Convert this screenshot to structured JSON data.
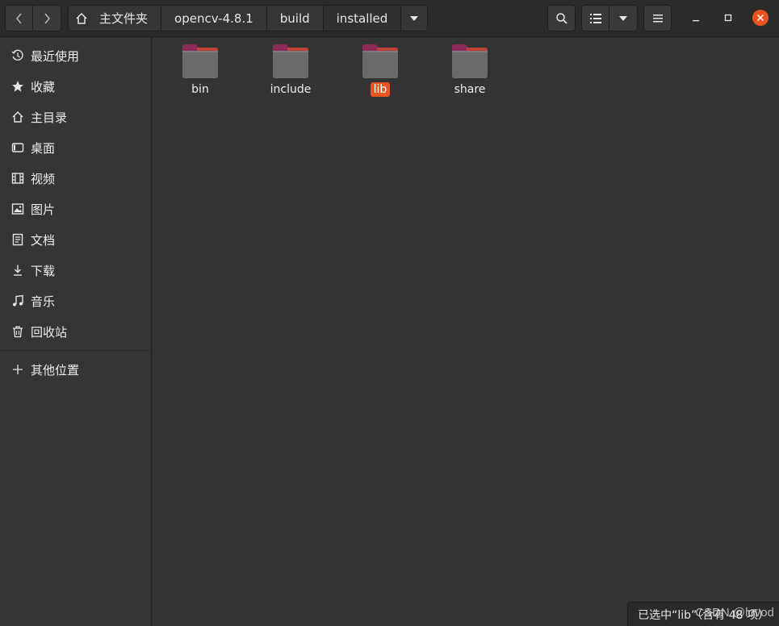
{
  "breadcrumb": {
    "items": [
      "主文件夹",
      "opencv-4.8.1",
      "build",
      "installed"
    ]
  },
  "icons": {
    "back": "chevron-left-icon",
    "forward": "chevron-right-icon",
    "home": "home-icon",
    "search": "search-icon",
    "list_view": "list-view-icon",
    "view_options": "chevron-down-icon",
    "menu": "hamburger-menu-icon",
    "minimize": "minimize-icon",
    "maximize": "maximize-icon",
    "close": "close-icon"
  },
  "sidebar": {
    "items": [
      {
        "label": "最近使用",
        "icon": "clock-icon"
      },
      {
        "label": "收藏",
        "icon": "star-icon"
      },
      {
        "label": "主目录",
        "icon": "home-icon"
      },
      {
        "label": "桌面",
        "icon": "desktop-icon"
      },
      {
        "label": "视频",
        "icon": "film-icon"
      },
      {
        "label": "图片",
        "icon": "image-icon"
      },
      {
        "label": "文档",
        "icon": "document-icon"
      },
      {
        "label": "下载",
        "icon": "download-icon"
      },
      {
        "label": "音乐",
        "icon": "music-icon"
      },
      {
        "label": "回收站",
        "icon": "trash-icon"
      }
    ],
    "other": {
      "label": "其他位置",
      "icon": "plus-icon"
    }
  },
  "files": [
    {
      "name": "bin",
      "selected": false
    },
    {
      "name": "include",
      "selected": false
    },
    {
      "name": "lib",
      "selected": true
    },
    {
      "name": "share",
      "selected": false
    }
  ],
  "status": {
    "text": "已选中“lib”（含有 48 项）"
  },
  "watermark": "CSDN @lovod",
  "colors": {
    "accent": "#e95420",
    "folder_tab": "#8d2a59",
    "folder_body": "#6a6a6a"
  }
}
